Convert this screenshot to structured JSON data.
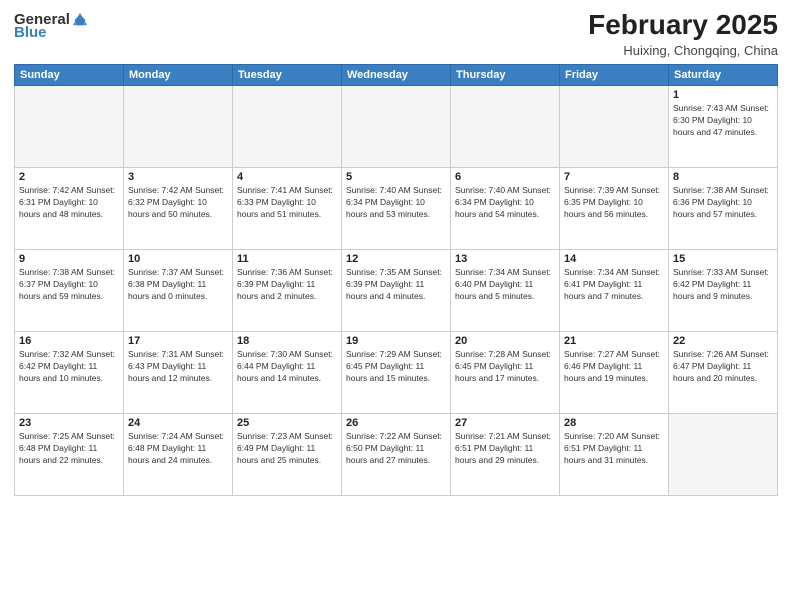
{
  "header": {
    "logo_general": "General",
    "logo_blue": "Blue",
    "month_year": "February 2025",
    "location": "Huixing, Chongqing, China"
  },
  "days_of_week": [
    "Sunday",
    "Monday",
    "Tuesday",
    "Wednesday",
    "Thursday",
    "Friday",
    "Saturday"
  ],
  "weeks": [
    [
      {
        "day": "",
        "info": ""
      },
      {
        "day": "",
        "info": ""
      },
      {
        "day": "",
        "info": ""
      },
      {
        "day": "",
        "info": ""
      },
      {
        "day": "",
        "info": ""
      },
      {
        "day": "",
        "info": ""
      },
      {
        "day": "1",
        "info": "Sunrise: 7:43 AM\nSunset: 6:30 PM\nDaylight: 10 hours and 47 minutes."
      }
    ],
    [
      {
        "day": "2",
        "info": "Sunrise: 7:42 AM\nSunset: 6:31 PM\nDaylight: 10 hours and 48 minutes."
      },
      {
        "day": "3",
        "info": "Sunrise: 7:42 AM\nSunset: 6:32 PM\nDaylight: 10 hours and 50 minutes."
      },
      {
        "day": "4",
        "info": "Sunrise: 7:41 AM\nSunset: 6:33 PM\nDaylight: 10 hours and 51 minutes."
      },
      {
        "day": "5",
        "info": "Sunrise: 7:40 AM\nSunset: 6:34 PM\nDaylight: 10 hours and 53 minutes."
      },
      {
        "day": "6",
        "info": "Sunrise: 7:40 AM\nSunset: 6:34 PM\nDaylight: 10 hours and 54 minutes."
      },
      {
        "day": "7",
        "info": "Sunrise: 7:39 AM\nSunset: 6:35 PM\nDaylight: 10 hours and 56 minutes."
      },
      {
        "day": "8",
        "info": "Sunrise: 7:38 AM\nSunset: 6:36 PM\nDaylight: 10 hours and 57 minutes."
      }
    ],
    [
      {
        "day": "9",
        "info": "Sunrise: 7:38 AM\nSunset: 6:37 PM\nDaylight: 10 hours and 59 minutes."
      },
      {
        "day": "10",
        "info": "Sunrise: 7:37 AM\nSunset: 6:38 PM\nDaylight: 11 hours and 0 minutes."
      },
      {
        "day": "11",
        "info": "Sunrise: 7:36 AM\nSunset: 6:39 PM\nDaylight: 11 hours and 2 minutes."
      },
      {
        "day": "12",
        "info": "Sunrise: 7:35 AM\nSunset: 6:39 PM\nDaylight: 11 hours and 4 minutes."
      },
      {
        "day": "13",
        "info": "Sunrise: 7:34 AM\nSunset: 6:40 PM\nDaylight: 11 hours and 5 minutes."
      },
      {
        "day": "14",
        "info": "Sunrise: 7:34 AM\nSunset: 6:41 PM\nDaylight: 11 hours and 7 minutes."
      },
      {
        "day": "15",
        "info": "Sunrise: 7:33 AM\nSunset: 6:42 PM\nDaylight: 11 hours and 9 minutes."
      }
    ],
    [
      {
        "day": "16",
        "info": "Sunrise: 7:32 AM\nSunset: 6:42 PM\nDaylight: 11 hours and 10 minutes."
      },
      {
        "day": "17",
        "info": "Sunrise: 7:31 AM\nSunset: 6:43 PM\nDaylight: 11 hours and 12 minutes."
      },
      {
        "day": "18",
        "info": "Sunrise: 7:30 AM\nSunset: 6:44 PM\nDaylight: 11 hours and 14 minutes."
      },
      {
        "day": "19",
        "info": "Sunrise: 7:29 AM\nSunset: 6:45 PM\nDaylight: 11 hours and 15 minutes."
      },
      {
        "day": "20",
        "info": "Sunrise: 7:28 AM\nSunset: 6:45 PM\nDaylight: 11 hours and 17 minutes."
      },
      {
        "day": "21",
        "info": "Sunrise: 7:27 AM\nSunset: 6:46 PM\nDaylight: 11 hours and 19 minutes."
      },
      {
        "day": "22",
        "info": "Sunrise: 7:26 AM\nSunset: 6:47 PM\nDaylight: 11 hours and 20 minutes."
      }
    ],
    [
      {
        "day": "23",
        "info": "Sunrise: 7:25 AM\nSunset: 6:48 PM\nDaylight: 11 hours and 22 minutes."
      },
      {
        "day": "24",
        "info": "Sunrise: 7:24 AM\nSunset: 6:48 PM\nDaylight: 11 hours and 24 minutes."
      },
      {
        "day": "25",
        "info": "Sunrise: 7:23 AM\nSunset: 6:49 PM\nDaylight: 11 hours and 25 minutes."
      },
      {
        "day": "26",
        "info": "Sunrise: 7:22 AM\nSunset: 6:50 PM\nDaylight: 11 hours and 27 minutes."
      },
      {
        "day": "27",
        "info": "Sunrise: 7:21 AM\nSunset: 6:51 PM\nDaylight: 11 hours and 29 minutes."
      },
      {
        "day": "28",
        "info": "Sunrise: 7:20 AM\nSunset: 6:51 PM\nDaylight: 11 hours and 31 minutes."
      },
      {
        "day": "",
        "info": ""
      }
    ]
  ]
}
